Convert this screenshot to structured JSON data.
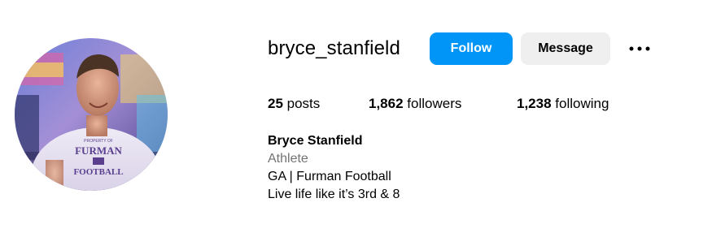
{
  "profile": {
    "username": "bryce_stanfield",
    "full_name": "Bryce Stanfield",
    "category": "Athlete",
    "bio_lines": [
      "GA | Furman Football",
      "Live life like it’s 3rd & 8"
    ],
    "shirt_text": [
      "PROPERTY OF",
      "FURMAN",
      "FOOTBALL"
    ]
  },
  "actions": {
    "follow_label": "Follow",
    "message_label": "Message",
    "more_icon": "more-horizontal-icon"
  },
  "stats": {
    "posts_count": "25",
    "posts_label": " posts",
    "followers_count": "1,862",
    "followers_label": " followers",
    "following_count": "1,238",
    "following_label": " following"
  },
  "colors": {
    "follow_button": "#0095f6",
    "message_button": "#efefef",
    "category_text": "#737373"
  }
}
